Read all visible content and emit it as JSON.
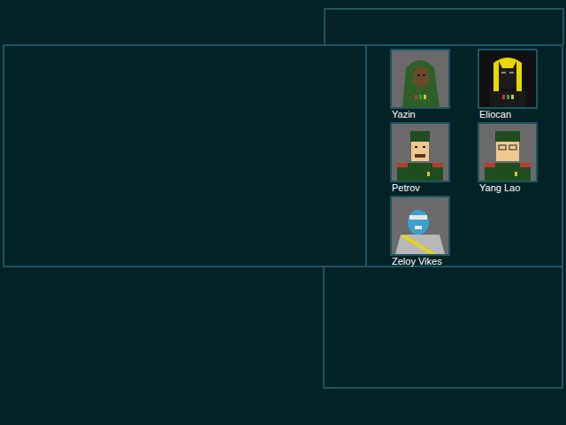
{
  "characters": [
    {
      "name": "Yazin",
      "kind": "hooded"
    },
    {
      "name": "Eliocan",
      "kind": "alien"
    },
    {
      "name": "Petrov",
      "kind": "officer-beard"
    },
    {
      "name": "Yang Lao",
      "kind": "officer-glasses"
    },
    {
      "name": "Zeloy Vikes",
      "kind": "masked"
    }
  ]
}
